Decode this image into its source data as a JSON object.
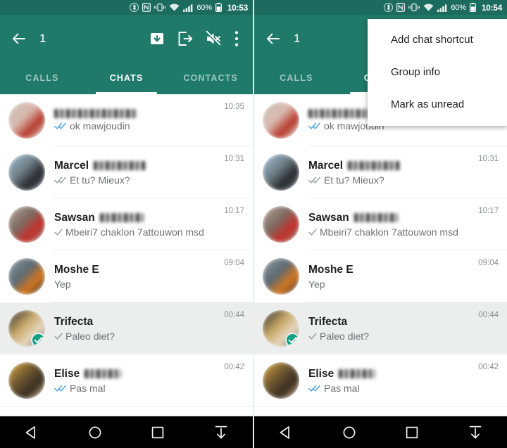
{
  "panels": [
    {
      "id": "left",
      "statusbar": {
        "icons": [
          "bluetooth-icon",
          "nfc-icon",
          "vibrate-icon",
          "wifi-icon",
          "signal-icon"
        ],
        "battery_text": "60%",
        "battery_icon": "battery-icon",
        "time": "10:53"
      },
      "toolbar": {
        "back_icon": "back-arrow-icon",
        "selection_count": "1",
        "actions": [
          {
            "name": "archive-button",
            "icon": "archive-icon"
          },
          {
            "name": "exit-group-button",
            "icon": "exit-icon"
          },
          {
            "name": "mute-button",
            "icon": "mute-icon"
          },
          {
            "name": "overflow-menu-button",
            "icon": "more-vertical-icon"
          }
        ]
      },
      "tabs": [
        {
          "label": "CALLS",
          "active": false
        },
        {
          "label": "CHATS",
          "active": true
        },
        {
          "label": "CONTACTS",
          "active": false
        }
      ],
      "menu_open": false
    },
    {
      "id": "right",
      "statusbar": {
        "icons": [
          "bluetooth-icon",
          "nfc-icon",
          "vibrate-icon",
          "wifi-icon",
          "signal-icon"
        ],
        "battery_text": "60%",
        "battery_icon": "battery-icon",
        "time": "10:54"
      },
      "toolbar": {
        "back_icon": "back-arrow-icon",
        "selection_count": "1",
        "actions": [
          {
            "name": "archive-button",
            "icon": "archive-icon"
          },
          {
            "name": "exit-group-button",
            "icon": "exit-icon"
          },
          {
            "name": "mute-button",
            "icon": "mute-icon"
          },
          {
            "name": "overflow-menu-button",
            "icon": "more-vertical-icon"
          }
        ]
      },
      "tabs": [
        {
          "label": "CALLS",
          "active": false
        },
        {
          "label": "CHATS",
          "active": true
        },
        {
          "label": "CONTACTS",
          "active": false
        }
      ],
      "menu_open": true,
      "menu": {
        "items": [
          {
            "label": "Add chat shortcut"
          },
          {
            "label": "Group info"
          },
          {
            "label": "Mark as unread"
          }
        ]
      }
    }
  ],
  "chats": [
    {
      "name": "",
      "name_blurred": true,
      "name_blur_width": 118,
      "message": "ok mawjoudin",
      "receipt": "double-check-read",
      "time": "10:35",
      "selected": false,
      "avatar_colors": [
        "#c9c2bd",
        "#d9b9ae",
        "#b63b2c",
        "#e8e2dd"
      ]
    },
    {
      "name": "Marcel",
      "name_blurred": true,
      "name_blur_width": 74,
      "message": "Et tu? Mieux?",
      "receipt": "double-check-sent",
      "time": "10:31",
      "selected": false,
      "avatar_colors": [
        "#9fc3d9",
        "#6f7d85",
        "#2a2d31",
        "#57606a"
      ]
    },
    {
      "name": "Sawsan",
      "name_blurred": true,
      "name_blur_width": 62,
      "message": "Mbeiri7 chaklon 7attouwon msd",
      "receipt": "single-check-sent",
      "time": "10:17",
      "selected": false,
      "avatar_colors": [
        "#b8a79d",
        "#7d6a60",
        "#c2312a",
        "#8c7a6e"
      ]
    },
    {
      "name": "Moshe E",
      "name_blurred": false,
      "name_blur_width": 0,
      "message": "Yep",
      "receipt": "none",
      "time": "09:04",
      "selected": false,
      "avatar_colors": [
        "#8e9aa3",
        "#5d6a72",
        "#d4761f",
        "#2c3339"
      ]
    },
    {
      "name": "Trifecta",
      "name_blurred": false,
      "name_blur_width": 0,
      "message": "Paleo diet?",
      "receipt": "single-check-sent",
      "time": "00:44",
      "selected": true,
      "avatar_colors": [
        "#2b2722",
        "#c8a96a",
        "#e6d7c0",
        "#53483a"
      ]
    },
    {
      "name": "Elise",
      "name_blurred": true,
      "name_blur_width": 52,
      "message": "Pas mal",
      "receipt": "double-check-read",
      "time": "00:42",
      "selected": false,
      "avatar_colors": [
        "#d9a43a",
        "#6b5530",
        "#3b2f22",
        "#c9ab7a"
      ]
    }
  ],
  "navbar": {
    "buttons": [
      {
        "name": "nav-back-button",
        "icon": "triangle-back-icon"
      },
      {
        "name": "nav-home-button",
        "icon": "circle-home-icon"
      },
      {
        "name": "nav-recents-button",
        "icon": "square-recents-icon"
      },
      {
        "name": "nav-hide-button",
        "icon": "arrow-down-bar-icon"
      }
    ]
  },
  "colors": {
    "toolbar_green": "#1f7a6a",
    "statusbar_green": "#1d6b5f",
    "badge_teal": "#13a085",
    "read_blue": "#4fa3e3",
    "selected_row": "#eceded"
  }
}
